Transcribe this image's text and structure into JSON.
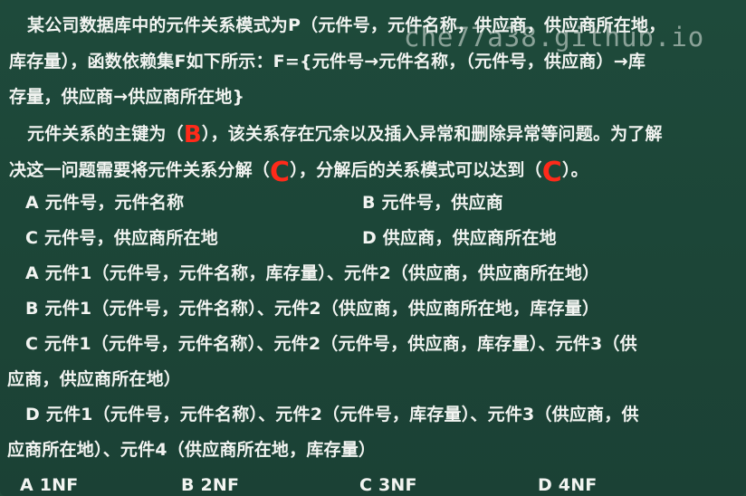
{
  "watermark": "che77a38.github.io",
  "lines": [
    "某公司数据库中的元件关系模式为P（元件号，元件名称，供应商，供应商所在地，",
    "库存量），函数依赖集F如下所示：F={元件号→元件名称，（元件号，供应商）→库",
    "存量，供应商→供应商所在地}"
  ],
  "q1": {
    "part1": "元件关系的主键为（",
    "answer": "B",
    "part2": "），该关系存在冗余以及插入异常和删除异常等问题。为了解"
  },
  "q2": {
    "part1": "决这一问题需要将元件关系分解（",
    "answer1": "C",
    "part2": "），分解后的关系模式可以达到（",
    "answer2": "C",
    "part3": "）。"
  },
  "options_a": {
    "A": "A 元件号，元件名称",
    "B": "B 元件号，供应商",
    "C": "C 元件号，供应商所在地",
    "D": "D 供应商，供应商所在地"
  },
  "options_b": {
    "A": "A 元件1（元件号，元件名称，库存量）、元件2（供应商，供应商所在地）",
    "B": "B 元件1（元件号，元件名称）、元件2（供应商，供应商所在地，库存量）",
    "C1": "C 元件1（元件号，元件名称）、元件2（元件号，供应商，库存量）、元件3（供",
    "C2": "应商，供应商所在地）",
    "D1": "D 元件1（元件号，元件名称）、元件2（元件号，库存量）、元件3（供应商，供",
    "D2": "应商所在地）、元件4（供应商所在地，库存量）"
  },
  "options_c": {
    "A": "A 1NF",
    "B": "B 2NF",
    "C": "C 3NF",
    "D": "D 4NF"
  }
}
